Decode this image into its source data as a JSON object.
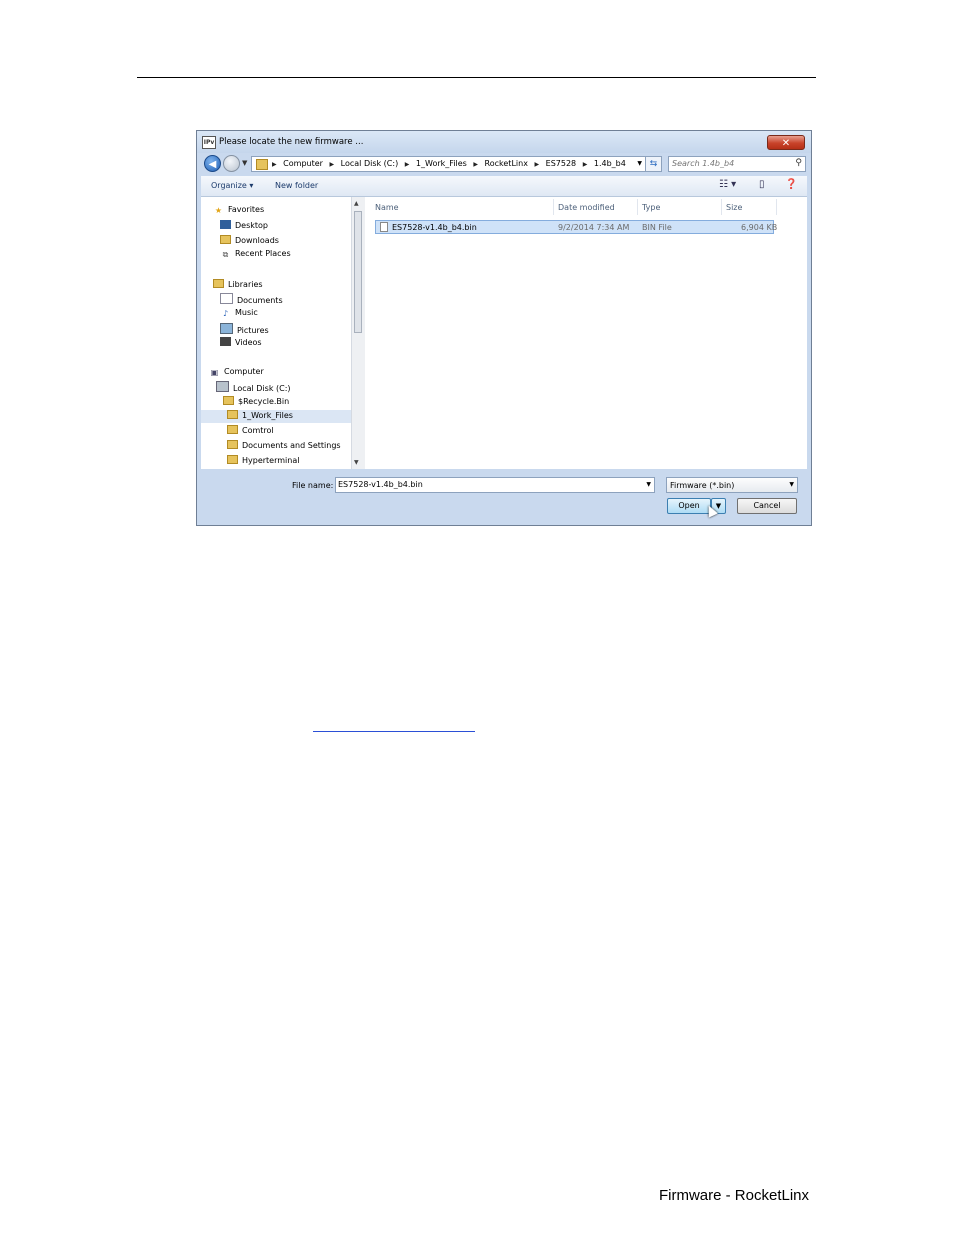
{
  "page": {
    "footer": "Firmware - RocketLinx"
  },
  "dialog": {
    "app_icon": "IPv",
    "title": "Please locate the new firmware ...",
    "close_icon": "close-icon",
    "breadcrumbs": [
      "Computer",
      "Local Disk (C:)",
      "1_Work_Files",
      "RocketLinx",
      "ES7528",
      "1.4b_b4"
    ],
    "search_placeholder": "Search 1.4b_b4",
    "toolbar": {
      "organize": "Organize ▾",
      "new_folder": "New folder"
    },
    "nav": {
      "favorites": "Favorites",
      "desktop": "Desktop",
      "downloads": "Downloads",
      "recent_places": "Recent Places",
      "libraries": "Libraries",
      "documents": "Documents",
      "music": "Music",
      "pictures": "Pictures",
      "videos": "Videos",
      "computer": "Computer",
      "local_disk": "Local Disk (C:)",
      "recycle_bin": "$Recycle.Bin",
      "work_files": "1_Work_Files",
      "comtrol": "Comtrol",
      "docs_settings": "Documents and Settings",
      "hyperterminal": "Hyperterminal"
    },
    "columns": {
      "name": "Name",
      "date_modified": "Date modified",
      "type": "Type",
      "size": "Size"
    },
    "files": [
      {
        "name": "ES7528-v1.4b_b4.bin",
        "date": "9/2/2014 7:34 AM",
        "type": "BIN File",
        "size": "6,904 KB"
      }
    ],
    "file_name_label": "File name:",
    "file_name_value": "ES7528-v1.4b_b4.bin",
    "filter": "Firmware (*.bin)",
    "open_label": "Open",
    "cancel_label": "Cancel"
  }
}
